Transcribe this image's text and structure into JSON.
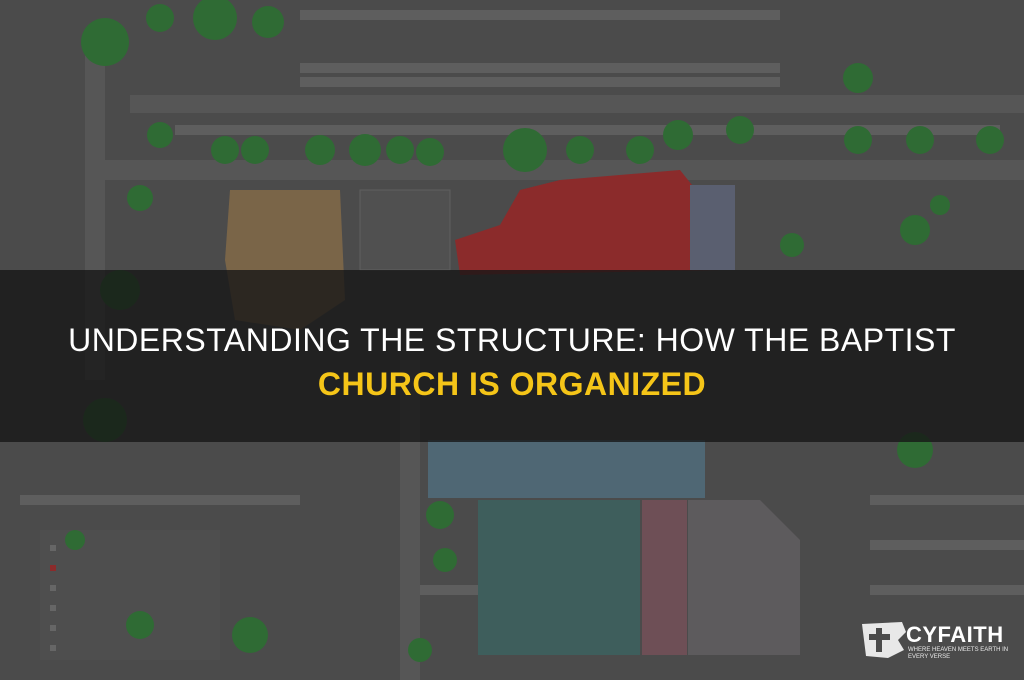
{
  "headline": {
    "line1": "UNDERSTANDING THE STRUCTURE: HOW THE BAPTIST",
    "line2": "CHURCH IS ORGANIZED",
    "accent_color": "#f5c518"
  },
  "background": {
    "description_icon": "site-plan-image",
    "colors": {
      "base": "#4a4a4a",
      "trees": "#2f6b34",
      "red_zone": "#8e2a2a",
      "tan_zone": "#7a6548",
      "blue_zone": "#4f6774",
      "teal_zone": "#3e5e5c",
      "pink_zone": "#6e4f56"
    }
  },
  "brand": {
    "name": "CYFAITH",
    "tagline": "WHERE HEAVEN MEETS EARTH IN EVERY VERSE",
    "icon": "cross-flag-logo-icon"
  }
}
